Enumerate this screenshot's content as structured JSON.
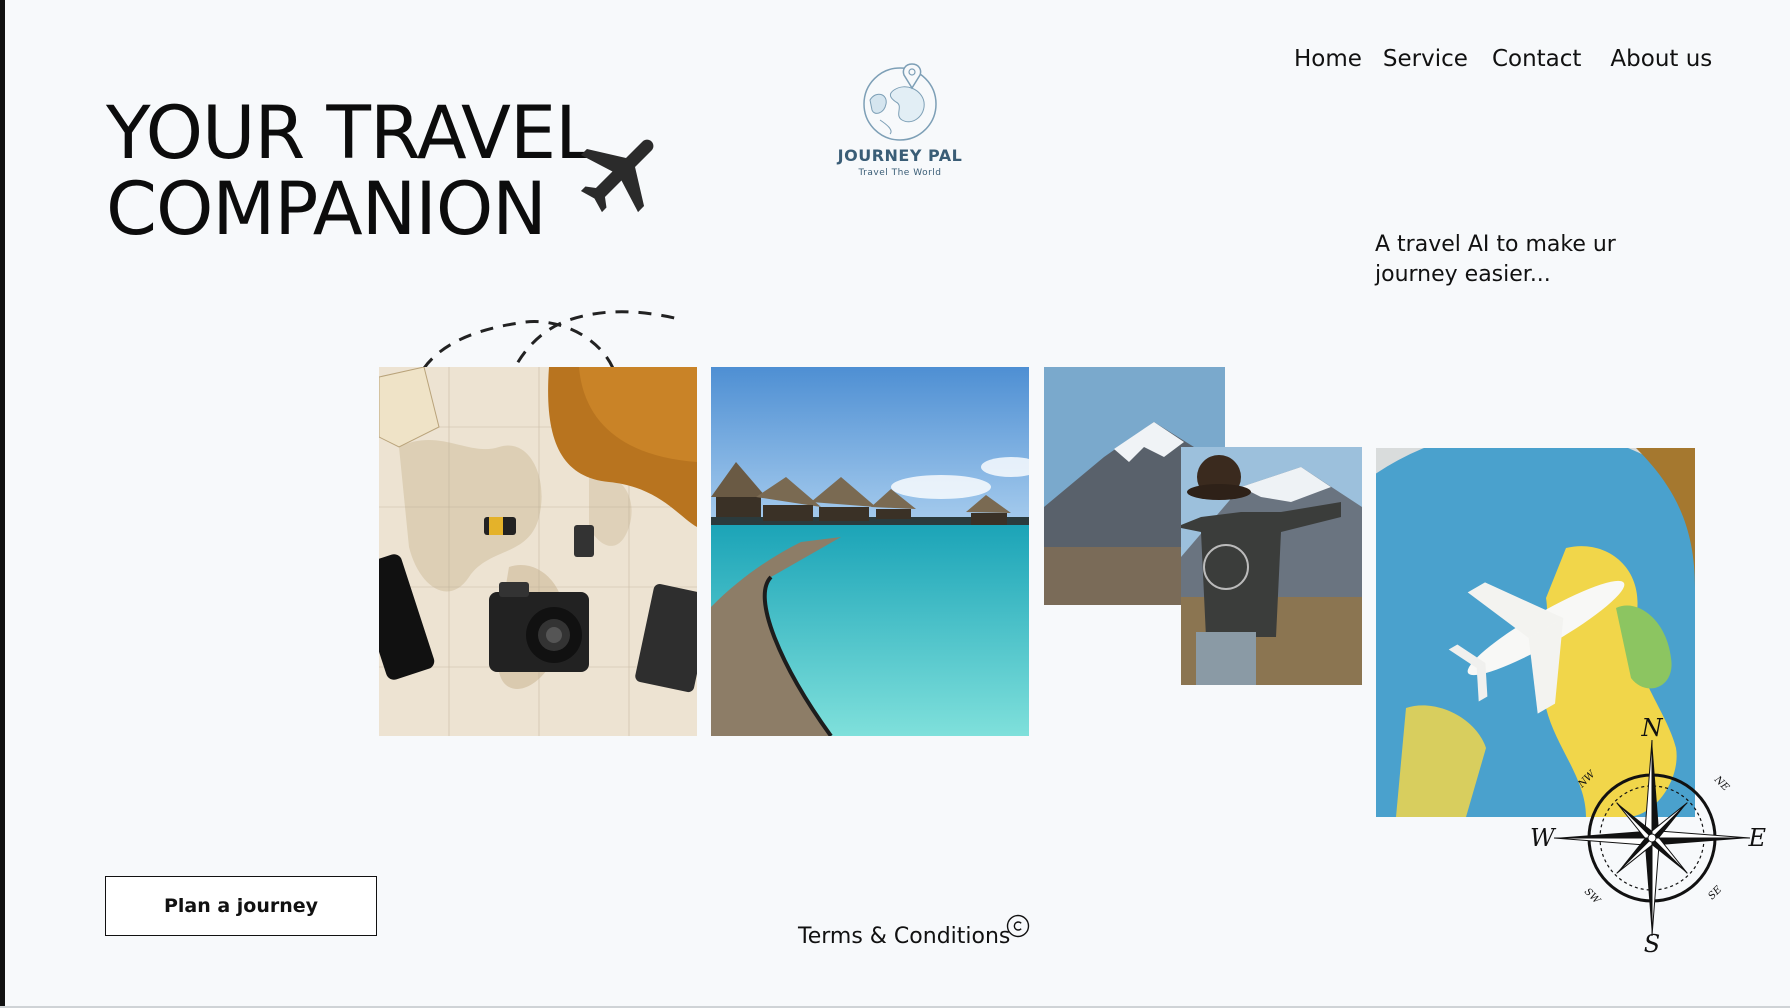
{
  "nav": {
    "items": [
      {
        "label": "Home"
      },
      {
        "label": "Service"
      },
      {
        "label": "Contact"
      },
      {
        "label": "About us"
      }
    ]
  },
  "hero": {
    "line1": "YOUR TRAVEL",
    "line2": "COMPANION"
  },
  "logo": {
    "name": "JOURNEY PAL",
    "tagline": "Travel The World"
  },
  "tagline": {
    "text": "A travel AI to make ur journey easier..."
  },
  "cta": {
    "plan_label": "Plan a journey"
  },
  "footer": {
    "terms_label": "Terms & Conditions"
  },
  "compass": {
    "n": "N",
    "s": "S",
    "e": "E",
    "w": "W",
    "ne": "NE",
    "nw": "NW",
    "se": "SE",
    "sw": "SW"
  },
  "icons": [
    "airplane-icon",
    "globe-logo-icon",
    "copyright-icon",
    "compass-rose-icon"
  ],
  "colors": {
    "background": "#f7f9fb",
    "text": "#111111",
    "logo": "#3a5d76"
  }
}
